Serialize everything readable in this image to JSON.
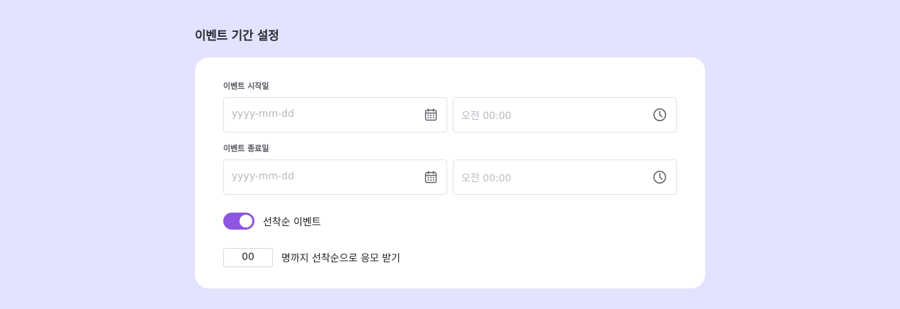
{
  "page": {
    "title": "이벤트 기간 설정"
  },
  "start": {
    "label": "이벤트 시작일",
    "date_placeholder": "yyyy-mm-dd",
    "time_placeholder": "오전 00:00",
    "date_icon": "calendar-icon",
    "time_icon": "clock-icon"
  },
  "end": {
    "label": "이벤트 종료일",
    "date_placeholder": "yyyy-mm-dd",
    "time_placeholder": "오전 00:00",
    "date_icon": "calendar-icon",
    "time_icon": "clock-icon"
  },
  "first_come": {
    "label": "선착순 이벤트",
    "enabled": true,
    "toggle_color": "#8e56e0"
  },
  "limit": {
    "value": "00",
    "suffix": "명까지 선착순으로 응모 받기"
  },
  "colors": {
    "background": "#e3e3ff",
    "card": "#ffffff",
    "accent": "#8e56e0"
  }
}
